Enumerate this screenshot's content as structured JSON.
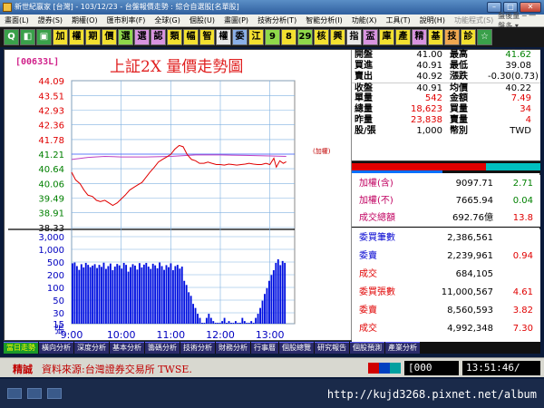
{
  "window": {
    "title": "新世紀嬴家 [台灣] - 103/12/23 - 台盤報價走勢 : 綜合自選股[名單股]"
  },
  "menu": {
    "items": [
      "畫面(L)",
      "證券(S)",
      "期權(O)",
      "匯市利率(F)",
      "全球(G)",
      "個股(U)",
      "畫圖(P)",
      "技術分析(T)",
      "智能分析(I)",
      "功能(X)",
      "工具(T)",
      "說明(H)"
    ],
    "disabled_item": "功能程式(S)",
    "right_text": "盤後量 ─ 一盤多 ▾"
  },
  "toolbar": {
    "buttons": [
      {
        "label": "Q",
        "color": "#3aa04a",
        "icon": "search-icon"
      },
      {
        "label": "◧",
        "color": "#3aa04a",
        "icon": "layout-icon"
      },
      {
        "label": "▣",
        "color": "#3aa04a",
        "icon": "grid-icon"
      },
      {
        "label": "加",
        "color": "#f3e030"
      },
      {
        "label": "權",
        "color": "#f3e030"
      },
      {
        "label": "期",
        "color": "#f3e030"
      },
      {
        "label": "價",
        "color": "#f3e030"
      },
      {
        "label": "選",
        "color": "#8fd84a"
      },
      {
        "label": "選",
        "color": "#d894e0"
      },
      {
        "label": "認",
        "color": "#d894e0"
      },
      {
        "label": "類",
        "color": "#f3e030"
      },
      {
        "label": "幅",
        "color": "#f3e030"
      },
      {
        "label": "智",
        "color": "#f3e030"
      },
      {
        "label": "權",
        "color": "#e8e8e8"
      },
      {
        "label": "委",
        "color": "#8ab0e8"
      },
      {
        "label": "江",
        "color": "#f3e030"
      },
      {
        "label": "9",
        "color": "#8fd84a"
      },
      {
        "label": "8",
        "color": "#f3e030"
      },
      {
        "label": "29",
        "color": "#8fd84a"
      },
      {
        "label": "核",
        "color": "#f3e030"
      },
      {
        "label": "興",
        "color": "#f3e030"
      },
      {
        "label": "指",
        "color": "#e8e8e8"
      },
      {
        "label": "盃",
        "color": "#d894e0"
      },
      {
        "label": "庫",
        "color": "#f3e030"
      },
      {
        "label": "產",
        "color": "#f3e030"
      },
      {
        "label": "精",
        "color": "#d894e0"
      },
      {
        "label": "基",
        "color": "#f3e030"
      },
      {
        "label": "技",
        "color": "#f0a850"
      },
      {
        "label": "診",
        "color": "#f3e030"
      },
      {
        "label": "☆",
        "color": "#3aa04a",
        "icon": "star-icon"
      }
    ]
  },
  "chart_header": {
    "ticker": "[00633L]",
    "title": "上証2X  量價走勢圖"
  },
  "chart_data": {
    "type": "line",
    "price_axis_ticks": [
      "44.09",
      "43.51",
      "42.93",
      "42.36",
      "41.78",
      "41.21",
      "40.64",
      "40.06",
      "39.49",
      "38.91",
      "38.33"
    ],
    "volume_axis_ticks": [
      "3,000",
      "1,000",
      "500",
      "200",
      "100",
      "50",
      "30",
      "15"
    ],
    "volume_unit": "張",
    "time_ticks": [
      "9:00",
      "10:00",
      "11:00",
      "12:00",
      "13:00"
    ],
    "ylim": [
      38.33,
      44.09
    ],
    "reference_price": 41.21,
    "reference_label": "(加權)",
    "price_series": [
      {
        "t": 9.0,
        "p": 40.5
      },
      {
        "t": 9.08,
        "p": 40.2
      },
      {
        "t": 9.17,
        "p": 40.05
      },
      {
        "t": 9.25,
        "p": 39.8
      },
      {
        "t": 9.33,
        "p": 39.6
      },
      {
        "t": 9.42,
        "p": 39.55
      },
      {
        "t": 9.5,
        "p": 39.4
      },
      {
        "t": 9.58,
        "p": 39.35
      },
      {
        "t": 9.67,
        "p": 39.4
      },
      {
        "t": 9.75,
        "p": 39.3
      },
      {
        "t": 9.83,
        "p": 39.2
      },
      {
        "t": 9.92,
        "p": 39.3
      },
      {
        "t": 10.0,
        "p": 39.45
      },
      {
        "t": 10.08,
        "p": 39.6
      },
      {
        "t": 10.17,
        "p": 39.8
      },
      {
        "t": 10.25,
        "p": 39.9
      },
      {
        "t": 10.33,
        "p": 40.0
      },
      {
        "t": 10.42,
        "p": 40.1
      },
      {
        "t": 10.5,
        "p": 40.3
      },
      {
        "t": 10.58,
        "p": 40.5
      },
      {
        "t": 10.67,
        "p": 40.7
      },
      {
        "t": 10.75,
        "p": 40.9
      },
      {
        "t": 10.83,
        "p": 41.0
      },
      {
        "t": 10.92,
        "p": 41.1
      },
      {
        "t": 11.0,
        "p": 41.2
      },
      {
        "t": 11.08,
        "p": 41.4
      },
      {
        "t": 11.17,
        "p": 41.55
      },
      {
        "t": 11.25,
        "p": 41.5
      },
      {
        "t": 11.33,
        "p": 41.2
      },
      {
        "t": 11.42,
        "p": 41.0
      },
      {
        "t": 11.5,
        "p": 40.95
      },
      {
        "t": 11.58,
        "p": 40.85
      },
      {
        "t": 11.67,
        "p": 40.85
      },
      {
        "t": 11.75,
        "p": 40.9
      },
      {
        "t": 11.83,
        "p": 40.85
      },
      {
        "t": 11.92,
        "p": 40.8
      },
      {
        "t": 12.0,
        "p": 40.8
      },
      {
        "t": 12.08,
        "p": 40.78
      },
      {
        "t": 12.17,
        "p": 40.82
      },
      {
        "t": 12.25,
        "p": 40.8
      },
      {
        "t": 12.33,
        "p": 40.78
      },
      {
        "t": 12.42,
        "p": 40.8
      },
      {
        "t": 12.5,
        "p": 40.82
      },
      {
        "t": 12.58,
        "p": 40.85
      },
      {
        "t": 12.67,
        "p": 40.82
      },
      {
        "t": 12.75,
        "p": 40.8
      },
      {
        "t": 12.83,
        "p": 40.8
      },
      {
        "t": 12.92,
        "p": 40.85
      },
      {
        "t": 13.0,
        "p": 40.8
      },
      {
        "t": 13.08,
        "p": 41.05
      },
      {
        "t": 13.13,
        "p": 40.7
      },
      {
        "t": 13.2,
        "p": 40.95
      },
      {
        "t": 13.27,
        "p": 40.85
      },
      {
        "t": 13.33,
        "p": 40.91
      }
    ],
    "avg_series": [
      {
        "t": 9.0,
        "p": 41.0
      },
      {
        "t": 9.33,
        "p": 41.08
      },
      {
        "t": 9.67,
        "p": 41.12
      },
      {
        "t": 10.0,
        "p": 41.1
      },
      {
        "t": 10.5,
        "p": 41.1
      },
      {
        "t": 11.0,
        "p": 41.12
      },
      {
        "t": 11.5,
        "p": 41.18
      },
      {
        "t": 12.0,
        "p": 41.18
      },
      {
        "t": 12.5,
        "p": 41.16
      },
      {
        "t": 13.0,
        "p": 41.14
      },
      {
        "t": 13.33,
        "p": 41.12
      }
    ],
    "volume_series": [
      680,
      720,
      560,
      430,
      640,
      510,
      700,
      610,
      520,
      580,
      640,
      490,
      610,
      530,
      710,
      460,
      560,
      670,
      420,
      540,
      650,
      590,
      470,
      700,
      610,
      380,
      520,
      640,
      580,
      440,
      690,
      510,
      620,
      700,
      540,
      460,
      660,
      590,
      480,
      720,
      560,
      430,
      600,
      520,
      680,
      420,
      560,
      610,
      470,
      540,
      200,
      150,
      90,
      70,
      40,
      30,
      20,
      15,
      10,
      10,
      15,
      20,
      15,
      12,
      10,
      10,
      10,
      12,
      15,
      10,
      12,
      10,
      10,
      12,
      10,
      10,
      15,
      12,
      10,
      10,
      12,
      10,
      15,
      20,
      30,
      50,
      80,
      120,
      200,
      300,
      420,
      700,
      900,
      600,
      800,
      700
    ]
  },
  "quote": {
    "rows": [
      {
        "l1": "開盤",
        "v1": "41.00",
        "c1": "blk",
        "l2": "最高",
        "v2": "41.62",
        "c2": "grn"
      },
      {
        "l1": "買進",
        "v1": "40.91",
        "c1": "blk",
        "l2": "最低",
        "v2": "39.08",
        "c2": "blk"
      },
      {
        "l1": "賣出",
        "v1": "40.92",
        "c1": "blk",
        "l2": "漲跌",
        "v2": "-0.30(0.73)",
        "c2": "blk"
      },
      {
        "l1": "收盤",
        "v1": "40.91",
        "c1": "blk",
        "l2": "均價",
        "v2": "40.22",
        "c2": "blk"
      },
      {
        "l1": "單量",
        "v1": "542",
        "c1": "red",
        "l2": "金額",
        "v2": "7.49",
        "c2": "red"
      },
      {
        "l1": "總量",
        "v1": "18,623",
        "c1": "red",
        "l2": "買量",
        "v2": "34",
        "c2": "red"
      },
      {
        "l1": "昨量",
        "v1": "23,838",
        "c1": "red",
        "l2": "賣量",
        "v2": "4",
        "c2": "red"
      },
      {
        "l1": "股/張",
        "v1": "1,000",
        "c1": "blk",
        "l2": "幣別",
        "v2": "TWD",
        "c2": "blk"
      }
    ]
  },
  "bidask": {
    "red_ratio": 0.71,
    "cyan_ratio": 0.29,
    "blue_ratio": 0.48
  },
  "index": {
    "rows": [
      {
        "label": "加權(含)",
        "value": "9097.71",
        "change": "2.71",
        "cc": "grn"
      },
      {
        "label": "加權(不)",
        "value": "7665.94",
        "change": "0.04",
        "cc": "grn"
      },
      {
        "label": "成交總額",
        "value": "692.76億",
        "change": "13.8",
        "cc": "red"
      }
    ]
  },
  "stats": {
    "rows": [
      {
        "label": "委買筆數",
        "value": "2,386,561",
        "pct": "",
        "lc": "blu",
        "pc": "red"
      },
      {
        "label": "委賣",
        "value": "2,239,961",
        "pct": "0.94",
        "lc": "blu",
        "pc": "red"
      },
      {
        "label": "成交",
        "value": "684,105",
        "pct": "",
        "lc": "red",
        "pc": "red"
      },
      {
        "label": "委買張數",
        "value": "11,000,567",
        "pct": "4.61",
        "lc": "red",
        "pc": "red"
      },
      {
        "label": "委賣",
        "value": "8,560,593",
        "pct": "3.82",
        "lc": "red",
        "pc": "red"
      },
      {
        "label": "成交",
        "value": "4,992,348",
        "pct": "7.30",
        "lc": "red",
        "pc": "red"
      }
    ]
  },
  "tabs": [
    "當日走勢",
    "橫向分析",
    "深度分析",
    "基本分析",
    "籌碼分析",
    "技術分析",
    "財務分析",
    "行事曆",
    "個股總覽",
    "研究報告",
    "個股預測",
    "產業分析"
  ],
  "status": {
    "label": "精誠",
    "ticker_text": "資料來源:台灣證券交易所 TWSE.",
    "count": "[000",
    "time": "13:51:46/"
  },
  "taskbar": {
    "watermark": "http://kujd3268.pixnet.net/album"
  }
}
